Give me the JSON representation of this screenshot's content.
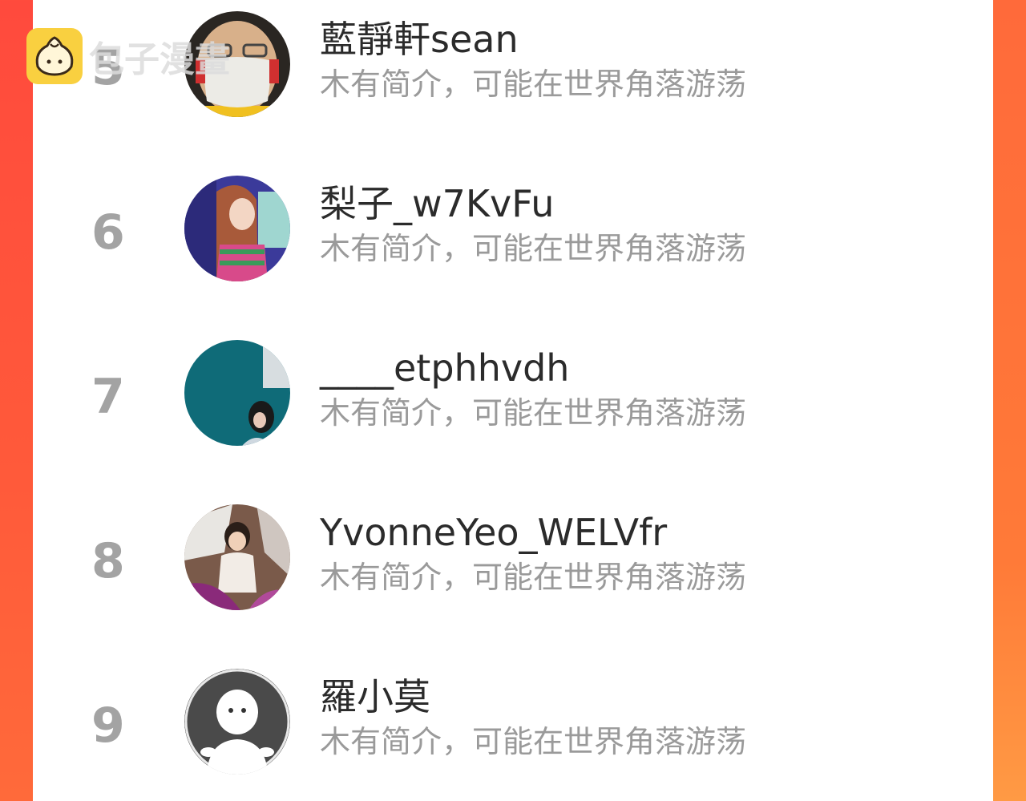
{
  "watermark": {
    "text": "包子漫畫",
    "icon": "bun-logo-icon"
  },
  "colors": {
    "background_left": "#ff4a3d",
    "background_right": "#ff7a38",
    "panel": "#ffffff",
    "rank": "#a3a3a3",
    "name": "#2b2b2b",
    "description": "#9a9a9a",
    "watermark_logo": "#f9d040"
  },
  "ranking_list": [
    {
      "rank": "5",
      "name": "藍靜軒sean",
      "description": "木有简介，可能在世界角落游荡",
      "avatar": "masked-person-avatar"
    },
    {
      "rank": "6",
      "name": "梨子_w7KvFu",
      "description": "木有简介，可能在世界角落游荡",
      "avatar": "anime-girl-avatar"
    },
    {
      "rank": "7",
      "name": "____etphhvdh",
      "description": "木有简介，可能在世界角落游荡",
      "avatar": "teal-wall-girl-avatar"
    },
    {
      "rank": "8",
      "name": "YvonneYeo_WELVfr",
      "description": "木有简介，可能在世界角落游荡",
      "avatar": "child-photo-avatar"
    },
    {
      "rank": "9",
      "name": "羅小莫",
      "description": "木有简介，可能在世界角落游荡",
      "avatar": "default-user-avatar"
    }
  ]
}
